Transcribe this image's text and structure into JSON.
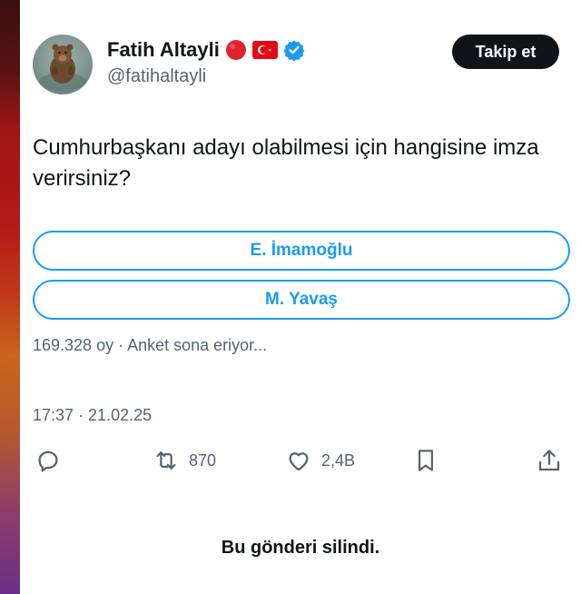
{
  "author": {
    "name": "Fatih Altayli",
    "handle": "@fatihaltayli",
    "badges": [
      "red-circle-icon",
      "turkey-flag-icon",
      "verified-icon"
    ]
  },
  "follow_label": "Takip et",
  "tweet_text": "Cumhurbaşkanı adayı olabilmesi için hangisine imza verirsiniz?",
  "poll": {
    "options": [
      "E. İmamoğlu",
      "M. Yavaş"
    ],
    "meta": "169.328 oy · Anket sona eriyor..."
  },
  "timestamp": "17:37 · 21.02.25",
  "actions": {
    "reply_icon": "reply-icon",
    "retweet_count": "870",
    "like_count": "2,4B",
    "bookmark_icon": "bookmark-icon",
    "share_icon": "share-icon"
  },
  "deleted_notice": "Bu gönderi silindi.",
  "colors": {
    "accent": "#1d9bf0",
    "text": "#0f1419",
    "muted": "#536471",
    "red": "#e0242c"
  }
}
